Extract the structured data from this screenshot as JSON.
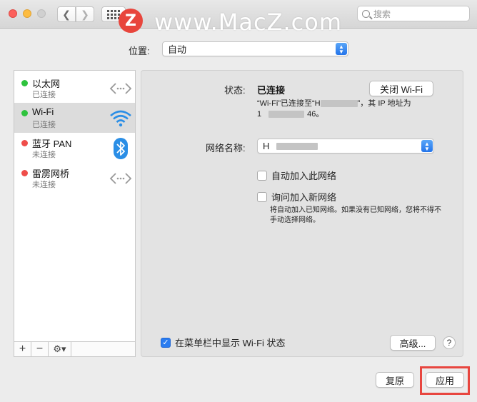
{
  "toolbar": {
    "search_placeholder": "搜索"
  },
  "watermark": {
    "logo_letter": "Z",
    "text": "www.MacZ.com"
  },
  "location": {
    "label": "位置:",
    "value": "自动"
  },
  "services": [
    {
      "name": "以太网",
      "status": "已连接",
      "dot": "#2ec33d",
      "icon": "ethernet-arrows-icon"
    },
    {
      "name": "Wi-Fi",
      "status": "已连接",
      "dot": "#2ec33d",
      "icon": "wifi-icon"
    },
    {
      "name": "蓝牙 PAN",
      "status": "未连接",
      "dot": "#ef4d4a",
      "icon": "bluetooth-icon"
    },
    {
      "name": "雷雳网桥",
      "status": "未连接",
      "dot": "#ef4d4a",
      "icon": "thunderbolt-bridge-arrows-icon"
    }
  ],
  "sidebar_toolbar": {
    "add": "+",
    "remove": "−",
    "gear": "⚙▾"
  },
  "wifi": {
    "status_label": "状态:",
    "status_value": "已连接",
    "status_desc_a": "“Wi-Fi”已连接至“H",
    "status_desc_b": "”，其 IP 地址为",
    "status_desc_c": "1",
    "status_desc_d": "46。",
    "turn_off_button": "关闭 Wi-Fi",
    "network_label": "网络名称:",
    "network_value": "H",
    "auto_join_label": "自动加入此网络",
    "ask_join_label": "询问加入新网络",
    "ask_join_note": "将自动加入已知网络。如果没有已知网络，您将不得不手动选择网络。",
    "show_in_menubar_label": "在菜单栏中显示 Wi-Fi 状态",
    "advanced_button": "高级...",
    "help_button": "?"
  },
  "footer": {
    "revert_button": "复原",
    "apply_button": "应用"
  },
  "colors": {
    "accent": "#2a7cf0",
    "highlight_frame": "#e8463f"
  }
}
